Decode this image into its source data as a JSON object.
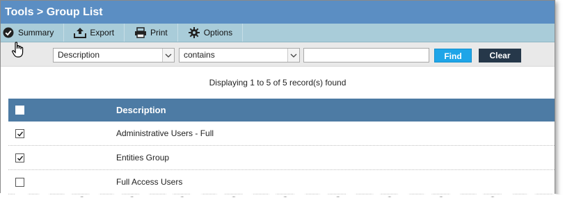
{
  "titlebar": {
    "title": "Tools > Group List"
  },
  "toolbar": {
    "summary": {
      "label": "Summary",
      "icon": "check-circle-icon"
    },
    "export": {
      "label": "Export",
      "icon": "upload-icon"
    },
    "print": {
      "label": "Print",
      "icon": "printer-icon"
    },
    "options": {
      "label": "Options",
      "icon": "gear-icon"
    }
  },
  "filter": {
    "field_value": "Description",
    "operator_value": "contains",
    "search_value": "",
    "find_label": "Find",
    "clear_label": "Clear"
  },
  "status": {
    "text": "Displaying 1 to 5 of 5 record(s) found"
  },
  "table": {
    "header": "Description",
    "rows": [
      {
        "description": "Administrative Users - Full",
        "checked": true
      },
      {
        "description": "Entities Group",
        "checked": true
      },
      {
        "description": "Full Access Users",
        "checked": false
      }
    ]
  },
  "colors": {
    "titlebar": "#5b8ec3",
    "toolbar": "#a9ccd9",
    "table_header": "#4d7ba4",
    "find_button": "#1ea5e8",
    "clear_button": "#26384a"
  }
}
